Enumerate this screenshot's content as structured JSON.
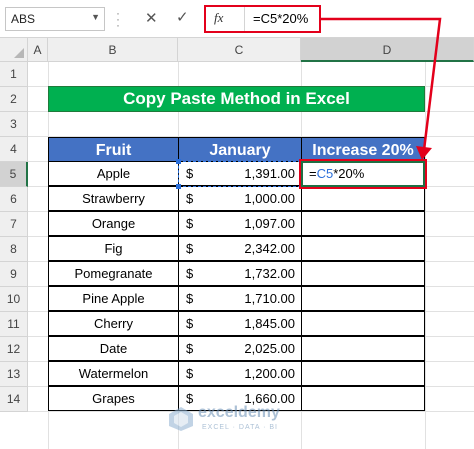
{
  "formula_bar": {
    "name_box": "ABS",
    "fx_label": "fx",
    "formula": "=C5*20%"
  },
  "columns": [
    "A",
    "B",
    "C",
    "D"
  ],
  "rows": [
    "1",
    "2",
    "3",
    "4",
    "5",
    "6",
    "7",
    "8",
    "9",
    "10",
    "11",
    "12",
    "13",
    "14"
  ],
  "title": "Copy Paste Method in Excel",
  "table": {
    "headers": [
      "Fruit",
      "January",
      "Increase 20%"
    ],
    "rows": [
      {
        "fruit": "Apple",
        "currency": "$",
        "amount": "1,391.00"
      },
      {
        "fruit": "Strawberry",
        "currency": "$",
        "amount": "1,000.00"
      },
      {
        "fruit": "Orange",
        "currency": "$",
        "amount": "1,097.00"
      },
      {
        "fruit": "Fig",
        "currency": "$",
        "amount": "2,342.00"
      },
      {
        "fruit": "Pomegranate",
        "currency": "$",
        "amount": "1,732.00"
      },
      {
        "fruit": "Pine Apple",
        "currency": "$",
        "amount": "1,710.00"
      },
      {
        "fruit": "Cherry",
        "currency": "$",
        "amount": "1,845.00"
      },
      {
        "fruit": "Date",
        "currency": "$",
        "amount": "2,025.00"
      },
      {
        "fruit": "Watermelon",
        "currency": "$",
        "amount": "1,200.00"
      },
      {
        "fruit": "Grapes",
        "currency": "$",
        "amount": "1,660.00"
      }
    ],
    "editing_cell": {
      "prefix": "=",
      "ref": "C5",
      "suffix": "*20%"
    }
  },
  "watermark": {
    "name": "exceldemy",
    "tagline": "EXCEL · DATA · BI"
  },
  "colors": {
    "title_bg": "#00b050",
    "header_bg": "#4472c4",
    "highlight": "#e3001b"
  }
}
